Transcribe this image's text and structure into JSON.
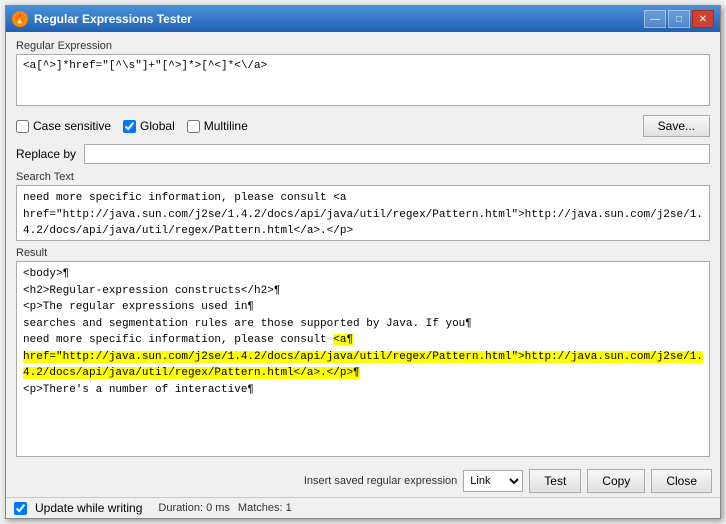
{
  "window": {
    "title": "Regular Expressions Tester",
    "icon": "🔥"
  },
  "title_controls": {
    "minimize": "—",
    "maximize": "□",
    "close": "✕"
  },
  "sections": {
    "regex_label": "Regular Expression",
    "search_label": "Search Text",
    "result_label": "Result"
  },
  "regex": {
    "value": "<a[^>]*href=\"[^\\s\"]+\"[^>]*>[^<]*<\\/a>"
  },
  "options": {
    "case_sensitive_label": "Case sensitive",
    "global_label": "Global",
    "multiline_label": "Multiline",
    "case_sensitive_checked": false,
    "global_checked": true,
    "multiline_checked": false,
    "save_label": "Save..."
  },
  "replace": {
    "label": "Replace by",
    "value": ""
  },
  "search_text": {
    "value": "need more specific information, please consult <a\nhref=\"http://java.sun.com/j2se/1.4.2/docs/api/java/util/regex/Pattern.html\">http://java.sun.com/j2se/1.4.2/docs/api/java/util/regex/Pattern.html</a>.</p>\n<p>There's a number of interactive\ntools available to develop and test regular expressions. The following"
  },
  "result": {
    "lines": [
      "<body>¶",
      "<h2>Regular-expression constructs</h2>¶",
      "<p>The regular expressions used in¶",
      "searches and segmentation rules are those supported by Java. If you¶",
      "need more specific information, please consult <a¶",
      "href=\"http://java.sun.com/j2se/1.4.2/docs/api/java/util/regex/Pattern.html\">http://",
      "//java.sun.com/j2se/1.4.2/docs/api/java/util/regex/Pattern.html</a>.</p>¶",
      "<p>There's a number of interactive¶"
    ],
    "highlight_start": 4,
    "highlight_end": 6
  },
  "bottom": {
    "insert_label": "Insert saved regular expression",
    "dropdown_value": "Link",
    "test_label": "Test",
    "copy_label": "Copy",
    "close_label": "Close"
  },
  "status": {
    "update_label": "Update while writing",
    "duration": "Duration: 0 ms",
    "matches": "Matches: 1"
  }
}
